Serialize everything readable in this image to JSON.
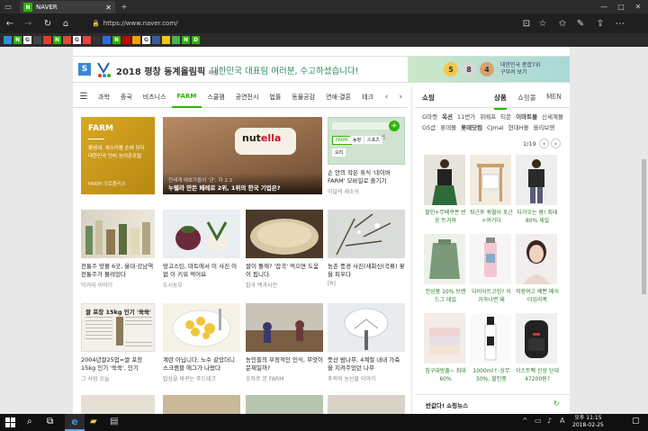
{
  "browser": {
    "tab_title": "NAVER",
    "tab_favicon": "N",
    "url": "https://www.naver.com/"
  },
  "banner": {
    "logo_letter": "S",
    "title": "2018 평창 동계올림픽",
    "title_suffix": "패럴",
    "subtitle": "대한민국 대표팀 여러분, 수고하셨습니다!",
    "medals": [
      "5",
      "8",
      "4"
    ],
    "medal_text_1": "대한민국 종합7위",
    "medal_text_2": "구부려 보기"
  },
  "categories": [
    "과학",
    "중국",
    "비즈니스",
    "FARM",
    "스쿨잼",
    "공연전시",
    "법률",
    "동물공감",
    "연애·결혼",
    "테크"
  ],
  "active_category": "FARM",
  "farm": {
    "label": "FARM",
    "desc1": "흙냄새, 새소리를 손에 담다",
    "desc2": "대한민국 단비 농어촌포털",
    "source": "FARM 크로폴리스"
  },
  "featured": {
    "overlay_line1": "전세계 애호가들의 '관', 하 2,3",
    "overlay_line2": "누텔라 만든 페레로 2위, 1위의 한국 기업은?"
  },
  "tipcard": {
    "tags": [
      "FARM",
      "농장",
      "스포츠",
      "요리"
    ],
    "title": "손 안의 작은 휴식 '네이버 FARM' 모바일로 즐기기",
    "source": "이달의 새소식"
  },
  "row2": [
    {
      "title": "전통주 맛볼 6곳, 울대·강남역 전통주가 몰려있다",
      "source": "막거리 이야기"
    },
    {
      "title": "망고스틴, 마트에서 이 사진 이 없 이 키워 먹어요",
      "source": "도시농부"
    },
    {
      "title": "쌀이 돌깨? '잡곡' 먹으면 도움이 됩니다.",
      "source": "잡곡 백과사전"
    },
    {
      "title": "농촌 풍경 사진(새화신(곡류) 꽃을 피우다",
      "source": "[R]"
    }
  ],
  "row3": [
    {
      "heading": "쌀 포장 15kg 인기 '쑥쑥'",
      "title": "2004년쌀25업=쌀 포장 15kg 인기 '쑥쑥', 인기",
      "source": "그 사람 오늘"
    },
    {
      "title": "계란 아닙니다, 노수 같았더니 스크램블 에그가 나왔다",
      "source": "밥상을 바꾸는 푸드테크"
    },
    {
      "title": "농민들의 부정적인 인식, 무엇이 문제일까?",
      "source": "숫자로 본 FARM"
    },
    {
      "title": "뜻산 밤나무, 4계절 내내 가축을 지켜주었던 나무",
      "source": "추억의 농산물 이야기"
    }
  ],
  "shop": {
    "header": "쇼핑",
    "tabs": [
      "상품",
      "쇼핑몰",
      "MEN"
    ],
    "cat_row1": [
      "G마켓",
      "옥션",
      "11번가",
      "위메프",
      "티몬",
      "이마트몰",
      "신세계몰"
    ],
    "cat_row2": [
      "GS샵",
      "롯데몰",
      "롯데닷컴",
      "CJmal",
      "현대H몰",
      "올리브영"
    ],
    "pager": "1/19",
    "items": [
      {
        "title": "할인+무배쿠폰 반응 트거와"
      },
      {
        "title": "퇴근후 쿼월어 포근+여기다"
      },
      {
        "title": "다가오는 봄! 최대 80% 세일"
      },
      {
        "title": "전상품 10% 브랜드그 데일"
      },
      {
        "title": "다이어트고민? 이거하나면 돼"
      },
      {
        "title": "직장여고 예쁜 메이 더임리폭"
      },
      {
        "title": "침구대방출~ 최대 60%"
      },
      {
        "title": "1000ml↑-상무 50%, 할인중"
      },
      {
        "title": "이스트팩 신상 단대 47200원?"
      }
    ],
    "footer": "반값다! 쇼핑뉴스"
  },
  "taskbar": {
    "ampm": "오후 11:15",
    "date": "2018-02-25"
  }
}
